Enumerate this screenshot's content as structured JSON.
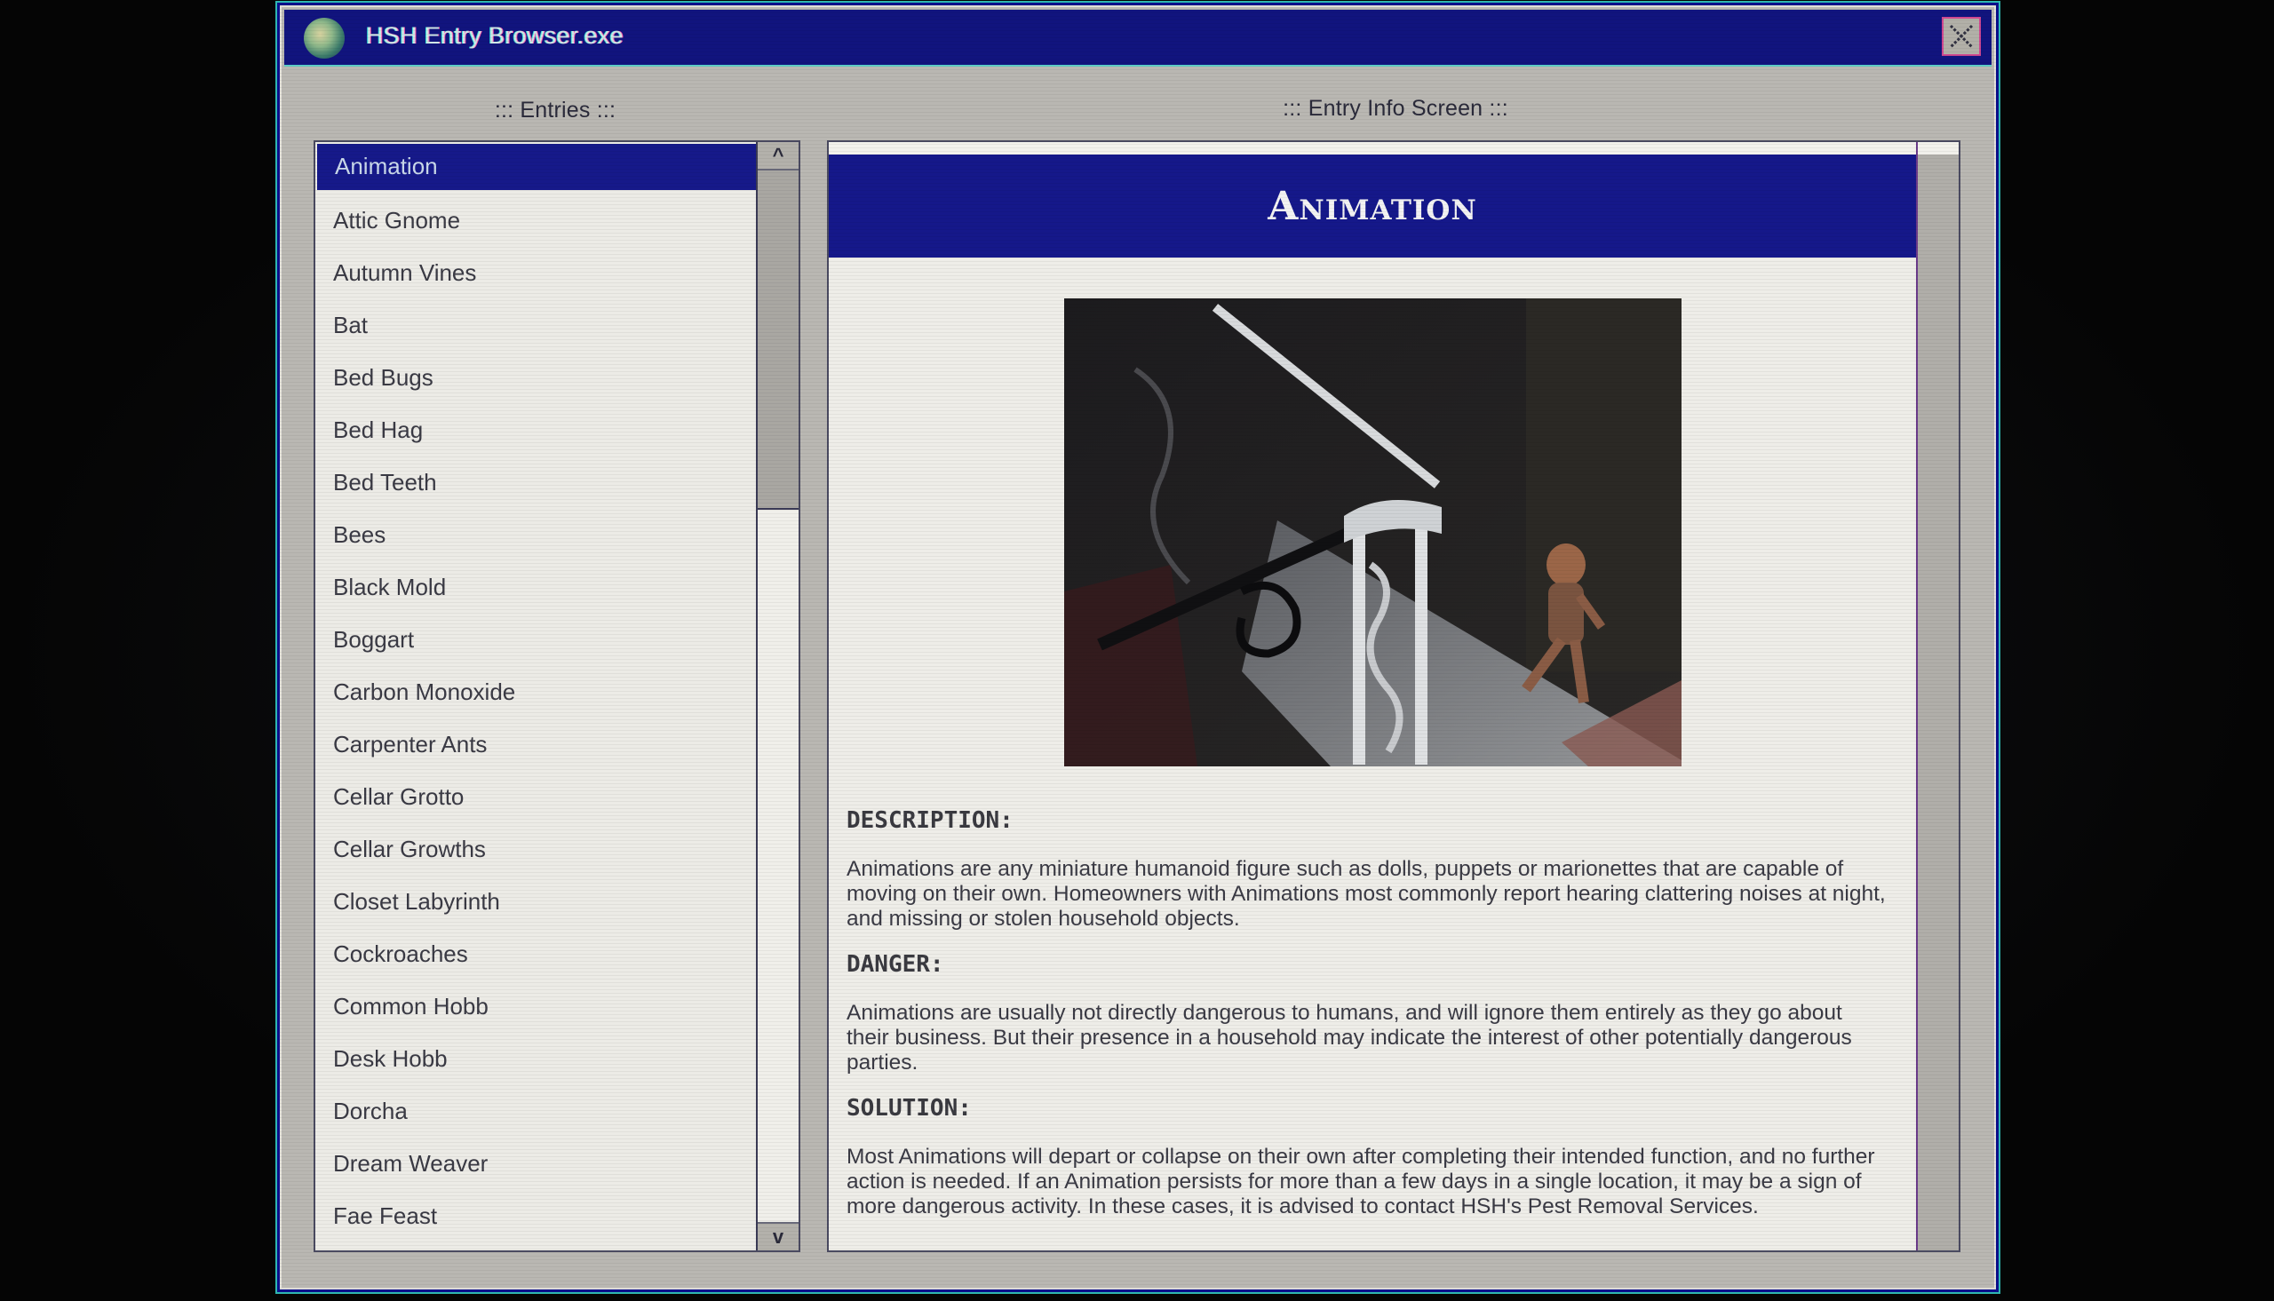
{
  "window": {
    "title": "HSH Entry Browser.exe",
    "icon": "brain-globe-icon",
    "close_icon": "close-icon"
  },
  "entries_panel": {
    "label": "::: Entries :::",
    "selected": "Animation",
    "scroll_up_label": "^",
    "scroll_down_label": "v",
    "items": [
      {
        "label": "Animation"
      },
      {
        "label": "Attic Gnome"
      },
      {
        "label": "Autumn Vines"
      },
      {
        "label": "Bat"
      },
      {
        "label": "Bed Bugs"
      },
      {
        "label": "Bed Hag"
      },
      {
        "label": "Bed Teeth"
      },
      {
        "label": "Bees"
      },
      {
        "label": "Black Mold"
      },
      {
        "label": "Boggart"
      },
      {
        "label": "Carbon Monoxide"
      },
      {
        "label": "Carpenter Ants"
      },
      {
        "label": "Cellar Grotto"
      },
      {
        "label": "Cellar Growths"
      },
      {
        "label": "Closet Labyrinth"
      },
      {
        "label": "Cockroaches"
      },
      {
        "label": "Common Hobb"
      },
      {
        "label": "Desk Hobb"
      },
      {
        "label": "Dorcha"
      },
      {
        "label": "Dream Weaver"
      },
      {
        "label": "Fae Feast"
      }
    ]
  },
  "info_panel": {
    "label": "::: Entry Info Screen :::",
    "entry_title": "Animation",
    "image_alt": "Animated puppet figure running down a staircase beside an ornate iron railing",
    "sections": [
      {
        "heading": "DESCRIPTION:",
        "body": "Animations are any miniature humanoid figure such as dolls, puppets or marionettes that are capable of moving on their own. Homeowners with Animations most commonly report hearing clattering noises at night, and missing or stolen household objects."
      },
      {
        "heading": "DANGER:",
        "body": "Animations are usually not directly dangerous to humans, and will ignore them entirely as they go about their business. But their presence in a household may indicate the interest of other potentially dangerous parties."
      },
      {
        "heading": "SOLUTION:",
        "body": "Most Animations will depart or collapse on their own after completing their intended function, and no further action is needed. If an Animation persists for more than a few days in a single location, it may be a sign of more dangerous activity. In these cases, it is advised to contact HSH's Pest Removal Services."
      }
    ]
  },
  "colors": {
    "titlebar": "#11147e",
    "selection": "#16198a",
    "window_bg": "#b9b7b2",
    "panel_bg": "#eeede8"
  }
}
